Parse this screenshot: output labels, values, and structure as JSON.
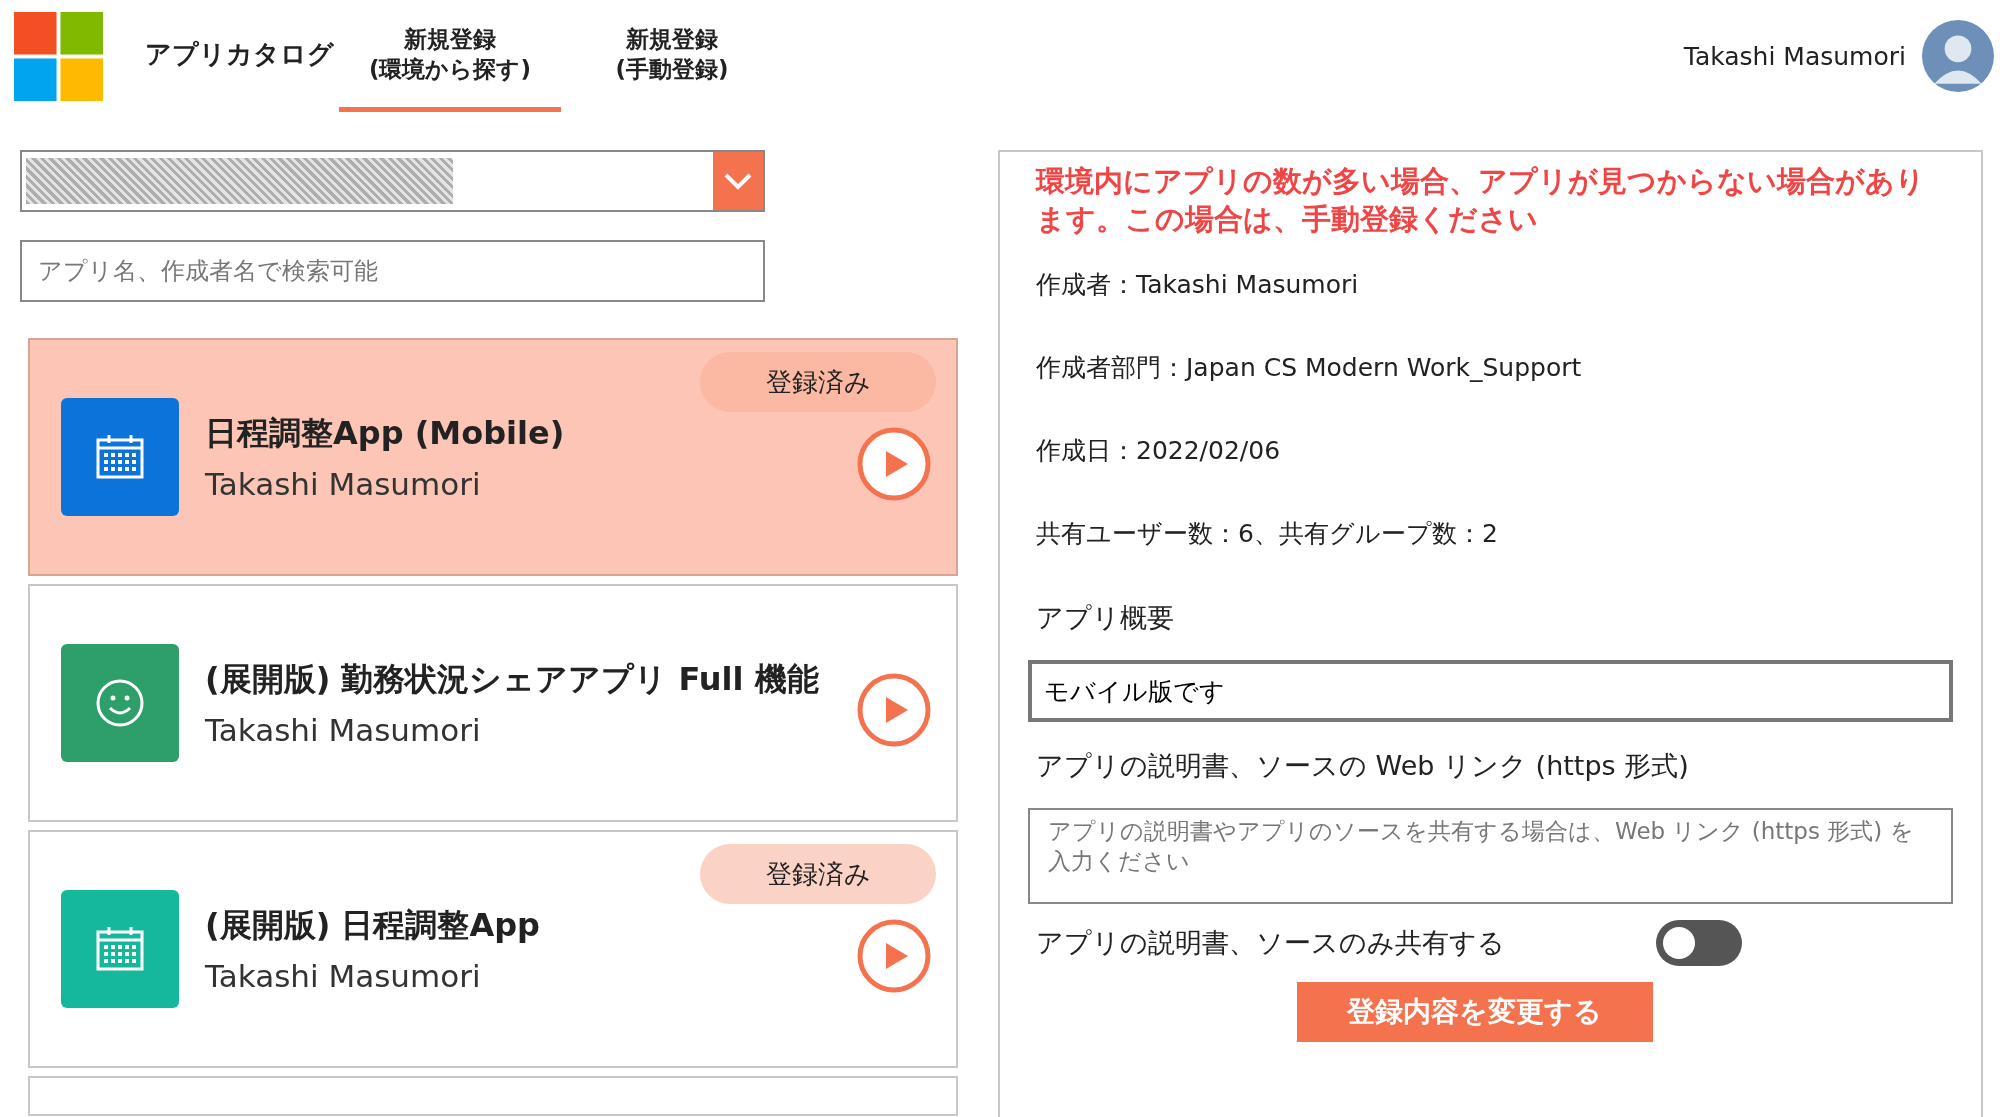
{
  "header": {
    "tabs": [
      {
        "label": "アプリカタログ",
        "selected": false
      },
      {
        "label": "新規登録\n(環境から探す)",
        "selected": true
      },
      {
        "label": "新規登録\n(手動登録)",
        "selected": false
      }
    ],
    "user_name": "Takashi Masumori"
  },
  "search": {
    "placeholder": "アプリ名、作成者名で検索可能"
  },
  "apps": [
    {
      "title": "日程調整App (Mobile)",
      "author": "Takashi Masumori",
      "registered": true,
      "badge": "登録済み",
      "selected": true,
      "kind": "calendar",
      "color": "#0b73d9"
    },
    {
      "title": "(展開版) 勤務状況シェアアプリ Full 機能",
      "author": "Takashi Masumori",
      "registered": false,
      "selected": false,
      "kind": "smiley",
      "color": "#2e9e6a"
    },
    {
      "title": "(展開版) 日程調整App",
      "author": "Takashi Masumori",
      "registered": true,
      "badge": "登録済み",
      "selected": false,
      "kind": "calendar",
      "color": "#16b89c"
    }
  ],
  "details": {
    "warning": "環境内にアプリの数が多い場合、アプリが見つからない場合があります。この場合は、手動登録ください",
    "info": [
      "作成者：Takashi Masumori",
      "作成者部門：Japan CS Modern Work_Support",
      "作成日：2022/02/06",
      "共有ユーザー数：6、共有グループ数：2"
    ],
    "summary_label": "アプリ概要",
    "summary_value": "モバイル版です",
    "link_label": "アプリの説明書、ソースの Web リンク (https 形式)",
    "link_placeholder": "アプリの説明書やアプリのソースを共有する場合は、Web リンク (https 形式) を入力ください",
    "share_only_label": "アプリの説明書、ソースのみ共有する",
    "share_only_on": false,
    "submit": "登録内容を変更する"
  }
}
